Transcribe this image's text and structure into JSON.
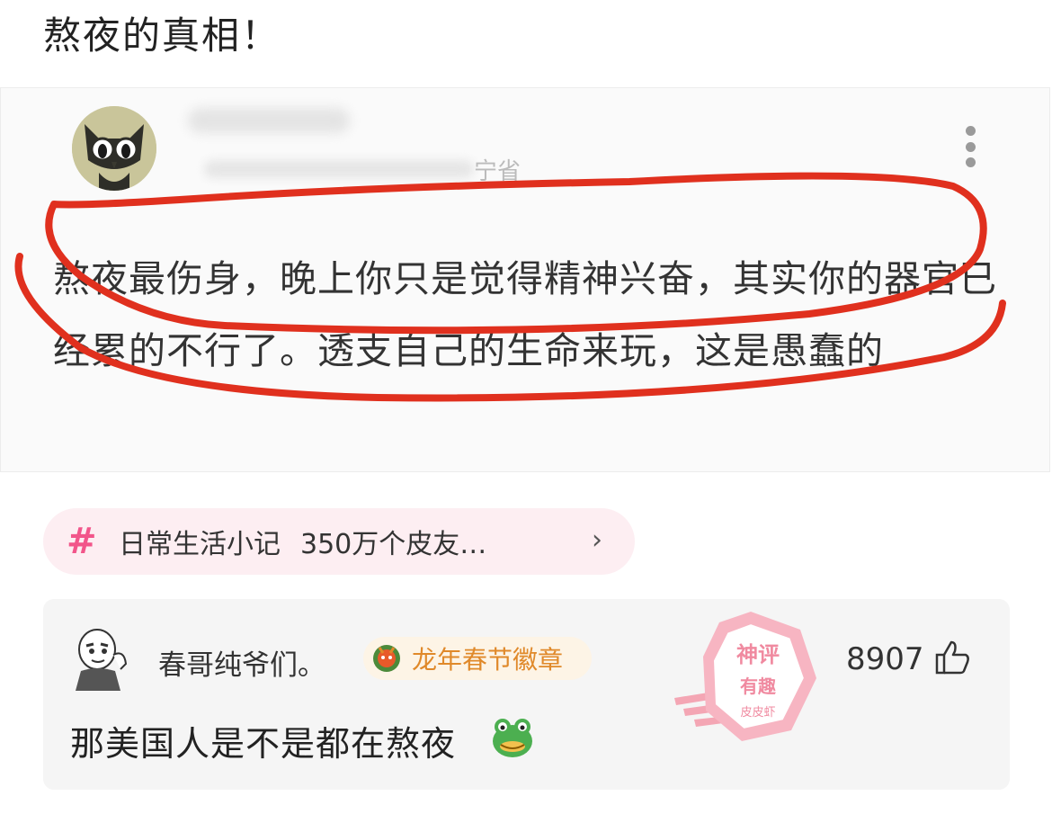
{
  "post": {
    "title": "熬夜的真相！"
  },
  "screenshot": {
    "location": "宁省",
    "quote": "熬夜最伤身，晚上你只是觉得精神兴奋，其实你的器官已经累的不行了。透支自己的生命来玩，这是愚蠢的"
  },
  "topic": {
    "name": "日常生活小记",
    "count": "350万个皮友…",
    "icon": "hash-icon",
    "arrow": "›"
  },
  "comment": {
    "author": "春哥纯爷们。",
    "badge": "龙年春节徽章",
    "likes": "8907",
    "text": "那美国人是不是都在熬夜",
    "stamp": {
      "line1": "神评",
      "line2": "有趣",
      "line3": "皮皮虾"
    }
  },
  "colors": {
    "accent_pink": "#f2558a",
    "badge_orange": "#e0892a",
    "annotation_red": "#e0301e"
  }
}
